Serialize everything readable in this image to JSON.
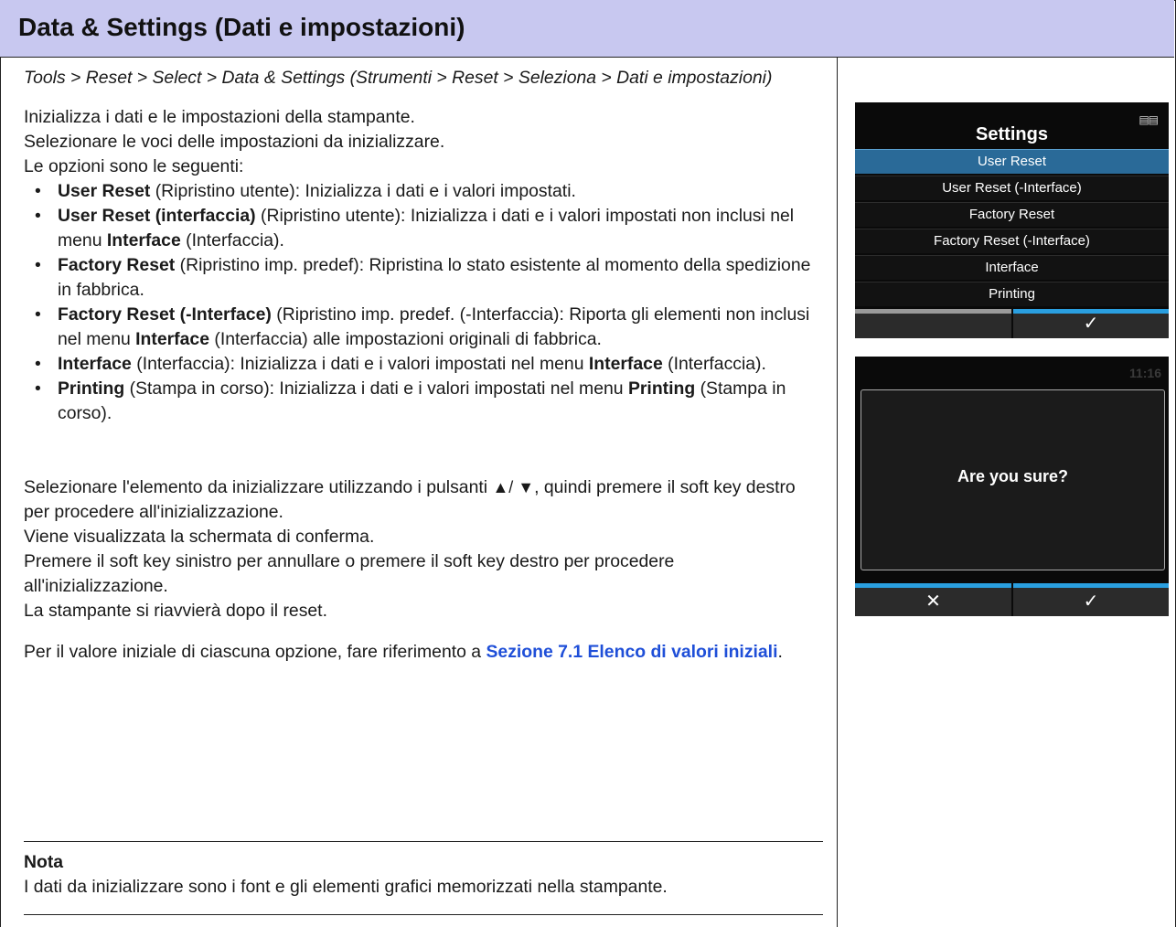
{
  "header": {
    "title": "Data & Settings (Dati e impostazioni)"
  },
  "body": {
    "path": "Tools > Reset > Select > Data & Settings (Strumenti > Reset > Seleziona > Dati e impostazioni)",
    "intro1": "Inizializza i dati e le impostazioni della stampante.",
    "intro2": "Selezionare le voci delle impostazioni da inizializzare.",
    "intro3": "Le opzioni sono le seguenti:",
    "options": [
      {
        "b": "User Reset",
        "t": " (Ripristino utente): Inizializza i dati e i valori impostati."
      },
      {
        "b": "User Reset (interfaccia)",
        "t": " (Ripristino utente): Inizializza i dati e i valori impostati non inclusi nel menu ",
        "b2": "Interface",
        "t2": " (Interfaccia)."
      },
      {
        "b": "Factory Reset",
        "t": " (Ripristino imp. predef): Ripristina lo stato esistente al momento della spedizione in fabbrica."
      },
      {
        "b": "Factory Reset (-Interface)",
        "t": " (Ripristino imp. predef. (-Interfaccia): Riporta gli elementi non inclusi nel menu ",
        "b2": "Interface",
        "t2": " (Interfaccia) alle impostazioni originali di fabbrica."
      },
      {
        "b": "Interface",
        "t": " (Interfaccia): Inizializza i dati e i valori impostati nel menu ",
        "b2": "Interface",
        "t2": " (Interfaccia)."
      },
      {
        "b": "Printing",
        "t": " (Stampa in corso): Inizializza i dati e i valori impostati nel menu ",
        "b2": "Printing",
        "t2": " (Stampa in corso)."
      }
    ],
    "select_pre": "Selezionare l'elemento da inizializzare utilizzando i pulsanti ",
    "arrows": "▲/ ▼",
    "select_post": ", quindi premere il soft key destro per procedere all'inizializzazione.",
    "confirm": "Viene visualizzata la schermata di conferma.",
    "press": "Premere il soft key sinistro per annullare o premere il soft key destro per procedere all'inizializzazione.",
    "restart": "La stampante si riavvierà dopo il reset.",
    "ref_pre": "Per il valore iniziale di ciascuna opzione, fare riferimento a ",
    "ref_link": "Sezione 7.1 Elenco di valori iniziali",
    "ref_post": "."
  },
  "note": {
    "title": "Nota",
    "text": "I dati da inizializzare sono i font e gli elementi grafici memorizzati nella stampante."
  },
  "screen1": {
    "title": "Settings",
    "items": [
      "User Reset",
      "User Reset (-Interface)",
      "Factory Reset",
      "Factory Reset (-Interface)",
      "Interface",
      "Printing"
    ],
    "selected_index": 0,
    "ok_icon": "✓",
    "network_icon": "network-icon"
  },
  "screen2": {
    "clock": "11:16",
    "dialog_text": "Are you sure?",
    "cancel_icon": "✕",
    "ok_icon": "✓"
  },
  "colors": {
    "header_bg": "#c8c8f0",
    "link": "#1f4fd8",
    "lcd_select": "#2a6a98",
    "lcd_accent": "#2a9fe0"
  }
}
